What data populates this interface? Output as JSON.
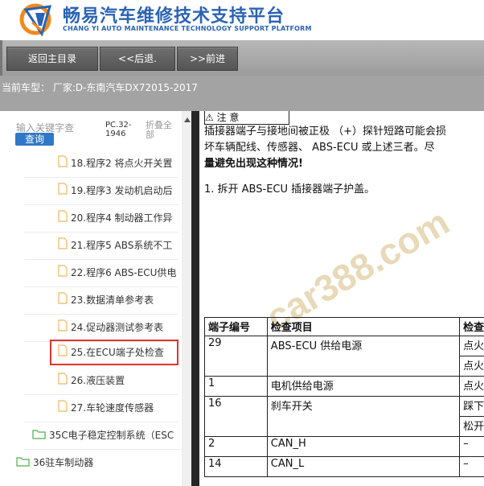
{
  "header": {
    "title": "畅易汽车维修技术支持平台",
    "subtitle": "CHANG YI AUTO MAINTENANCE TECHNOLOGY SUPPORT PLATFORM",
    "logo_icon": "chang-yi-logo-icon"
  },
  "toolbar": {
    "home_label": "返回主目录",
    "back_label": "<<后退.",
    "forward_label": ">>前进"
  },
  "vehicle_bar": {
    "label": "当前车型：  厂家:D-东南汽车DX72015-2017"
  },
  "sidebar": {
    "search_placeholder": "输入关键字查",
    "query_label": "查询",
    "pc_label": "PC.32-1946",
    "fold_label": "折叠全部",
    "items": [
      {
        "label": "18.程序2 将点火开关置",
        "type": "doc"
      },
      {
        "label": "19.程序3 发动机启动后",
        "type": "doc"
      },
      {
        "label": "20.程序4 制动器工作异",
        "type": "doc"
      },
      {
        "label": "21.程序5 ABS系统不工",
        "type": "doc"
      },
      {
        "label": "22.程序6 ABS-ECU供电",
        "type": "doc"
      },
      {
        "label": "23.数据清单参考表",
        "type": "doc"
      },
      {
        "label": "24.促动器测试参考表",
        "type": "doc"
      },
      {
        "label": "25.在ECU端子处检查",
        "type": "doc",
        "selected": true
      },
      {
        "label": "26.液压装置",
        "type": "doc"
      },
      {
        "label": "27.车轮速度传感器",
        "type": "doc"
      },
      {
        "label": "35C电子稳定控制系统（ESC",
        "type": "folder"
      },
      {
        "label": "36驻车制动器",
        "type": "folder"
      }
    ]
  },
  "content": {
    "notice": "⚠   注  意",
    "warning_lines": [
      "插接器端子与接地间被正极 （+）探针短路可能会损",
      "坏车辆配线、传感器、 ABS-ECU  或上述三者。尽",
      "量避免出现这种情况!"
    ],
    "step1": "1. 拆开 ABS-ECU 插接器端子护盖。",
    "watermark": "car388.com",
    "table": {
      "headers": [
        "端子编号",
        "检查项目",
        "检查"
      ],
      "rows": [
        [
          "29",
          "ABS-ECU 供给电源",
          "点火"
        ],
        [
          "",
          "",
          "点火"
        ],
        [
          "1",
          "电机供给电源",
          "点火"
        ],
        [
          "16",
          "刹车开关",
          "踩下"
        ],
        [
          "",
          "",
          "松开"
        ],
        [
          "2",
          "CAN_H",
          "–"
        ],
        [
          "14",
          "CAN_L",
          "–"
        ]
      ]
    }
  },
  "colors": {
    "brand_blue": "#2a63b5",
    "query_blue": "#2f78c7",
    "highlight_red": "#e0352e",
    "doc_icon": "#f0b860",
    "folder_icon": "#4caf50"
  }
}
